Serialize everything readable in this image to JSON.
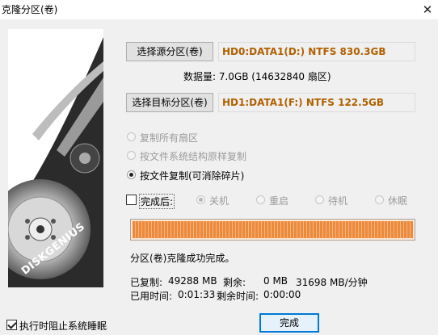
{
  "window": {
    "title": "克隆分区(卷)",
    "close_label": "✕"
  },
  "artwork": {
    "brand": "DISKGENIUS"
  },
  "source": {
    "button_label": "选择源分区(卷)",
    "value": "HD0:DATA1(D:) NTFS 830.3GB",
    "data_size": "数据量: 7.0GB (14632840 扇区)"
  },
  "target": {
    "button_label": "选择目标分区(卷)",
    "value": "HD1:DATA1(F:) NTFS 122.5GB"
  },
  "copy_modes": [
    {
      "label": "复制所有扇区",
      "selected": false,
      "enabled": false
    },
    {
      "label": "按文件系统结构原样复制",
      "selected": false,
      "enabled": false
    },
    {
      "label": "按文件复制(可消除碎片)",
      "selected": true,
      "enabled": true
    }
  ],
  "after_complete": {
    "label": "完成后:",
    "checked": false,
    "options": [
      {
        "label": "关机",
        "selected": true
      },
      {
        "label": "重启",
        "selected": false
      },
      {
        "label": "待机",
        "selected": false
      },
      {
        "label": "休眠",
        "selected": false
      }
    ]
  },
  "progress": {
    "percent": 100
  },
  "status": {
    "message": "分区(卷)克隆成功完成。"
  },
  "stats": {
    "copied_label": "已复制:",
    "copied_value": "49288 MB",
    "remaining_label": "剩余:",
    "remaining_value": "0 MB",
    "speed": "31698 MB/分钟",
    "elapsed_label": "已用时间:",
    "elapsed_value": "0:01:33",
    "left_label": "剩余时间:",
    "left_value": "0:00:00"
  },
  "prevent_sleep": {
    "label": "执行时阻止系统睡眠",
    "checked": true
  },
  "done_button": {
    "label": "完成"
  },
  "colors": {
    "accent_text": "#b06000",
    "progress": "#ec8a3c",
    "focus_border": "#0078d7"
  }
}
